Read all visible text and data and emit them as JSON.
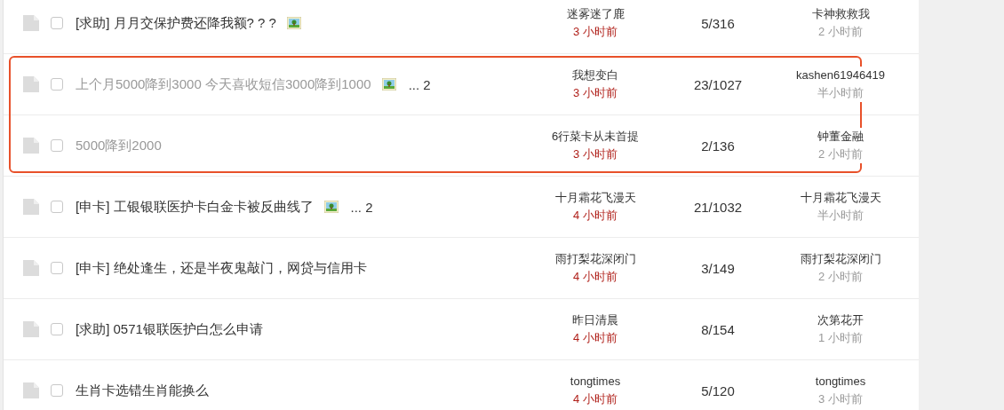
{
  "threads": [
    {
      "title": "[求助] 月月交保护费还降我额? ? ?",
      "has_image": true,
      "visited": false,
      "marked": false,
      "author": "迷雾迷了鹿",
      "posted": "3 小时前",
      "counts": "5/316",
      "last_user": "卡神救救我",
      "last_time": "2 小时前",
      "checked": false
    },
    {
      "title": "上个月5000降到3000 今天喜收短信3000降到1000",
      "has_image": true,
      "pages": "... 2",
      "visited": true,
      "marked": true,
      "author": "我想变白",
      "posted": "3 小时前",
      "counts": "23/1027",
      "last_user": "kashen61946419",
      "last_time": "半小时前",
      "checked": false
    },
    {
      "title": "5000降到2000",
      "has_image": false,
      "visited": true,
      "marked": true,
      "author": "6行菜卡从未首提",
      "posted": "3 小时前",
      "counts": "2/136",
      "last_user": "钟董金融",
      "last_time": "2 小时前",
      "checked": false
    },
    {
      "title": "[申卡] 工银银联医护卡白金卡被反曲线了",
      "has_image": true,
      "pages": "... 2",
      "visited": false,
      "marked": false,
      "author": "十月霜花飞漫天",
      "posted": "4 小时前",
      "counts": "21/1032",
      "last_user": "十月霜花飞漫天",
      "last_time": "半小时前",
      "checked": false
    },
    {
      "title": "[申卡] 绝处逢生，还是半夜鬼敲门，网贷与信用卡",
      "has_image": false,
      "visited": false,
      "marked": false,
      "author": "雨打梨花深闭门",
      "posted": "4 小时前",
      "counts": "3/149",
      "last_user": "雨打梨花深闭门",
      "last_time": "2 小时前",
      "checked": false
    },
    {
      "title": "[求助] 0571银联医护白怎么申请",
      "has_image": false,
      "visited": false,
      "marked": false,
      "author": "昨日清晨",
      "posted": "4 小时前",
      "counts": "8/154",
      "last_user": "次第花开",
      "last_time": "1 小时前",
      "checked": false
    },
    {
      "title": "生肖卡选错生肖能换么",
      "has_image": false,
      "visited": false,
      "marked": false,
      "author": "tongtimes",
      "posted": "4 小时前",
      "counts": "5/120",
      "last_user": "tongtimes",
      "last_time": "3 小时前",
      "checked": false
    }
  ]
}
